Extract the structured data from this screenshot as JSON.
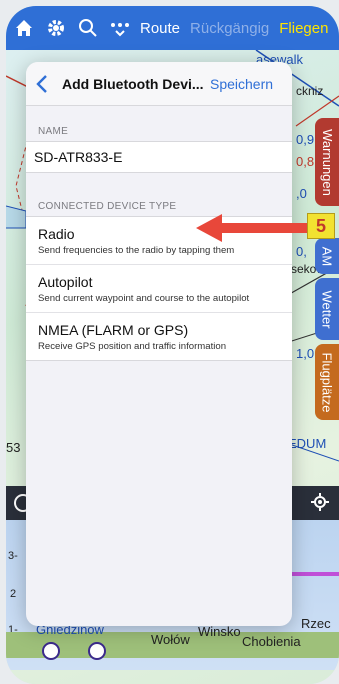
{
  "toolbar": {
    "route_label": "Route",
    "undo_label": "Rückgängig",
    "fly_label": "Fliegen"
  },
  "map": {
    "labels": {
      "top_right": "asewalk",
      "right1": "ckniz",
      "right_num1": "0,9",
      "right_num2": "0,8",
      "right_num3": ",0",
      "right_num4": "0,",
      "right_num5": "1,0",
      "right_num6": "sekow",
      "left_53": "53",
      "right_edum": "EDUM",
      "bottom_gniezno": "Gniedzinow",
      "bottom_wolow": "Wołów",
      "bottom_winsko": "Winsko",
      "bottom_chobienia": "Chobienia",
      "bottom_rzec": "Rzec"
    }
  },
  "side_tabs": {
    "warnings": "Warnungen",
    "am": "AM",
    "weather": "Wetter",
    "airports": "Flugplätze"
  },
  "profile": {
    "tick3": "3-",
    "tick2": "2",
    "tick1": "1-"
  },
  "sheet": {
    "title": "Add Bluetooth Devi...",
    "save_label": "Speichern",
    "name_header": "NAME",
    "name_value": "SD-ATR833-E",
    "type_header": "CONNECTED DEVICE TYPE",
    "options": [
      {
        "title": "Radio",
        "subtitle": "Send frequencies to the radio by tapping them"
      },
      {
        "title": "Autopilot",
        "subtitle": "Send current waypoint and course to the autopilot"
      },
      {
        "title": "NMEA (FLARM or GPS)",
        "subtitle": "Receive GPS position and traffic information"
      }
    ]
  },
  "annotation": {
    "badge": "5"
  },
  "colors": {
    "toolbar": "#2f6fd6",
    "accent": "#2f6fd6",
    "annotation_arrow": "#e8473a",
    "annotation_badge": "#f2e230"
  }
}
